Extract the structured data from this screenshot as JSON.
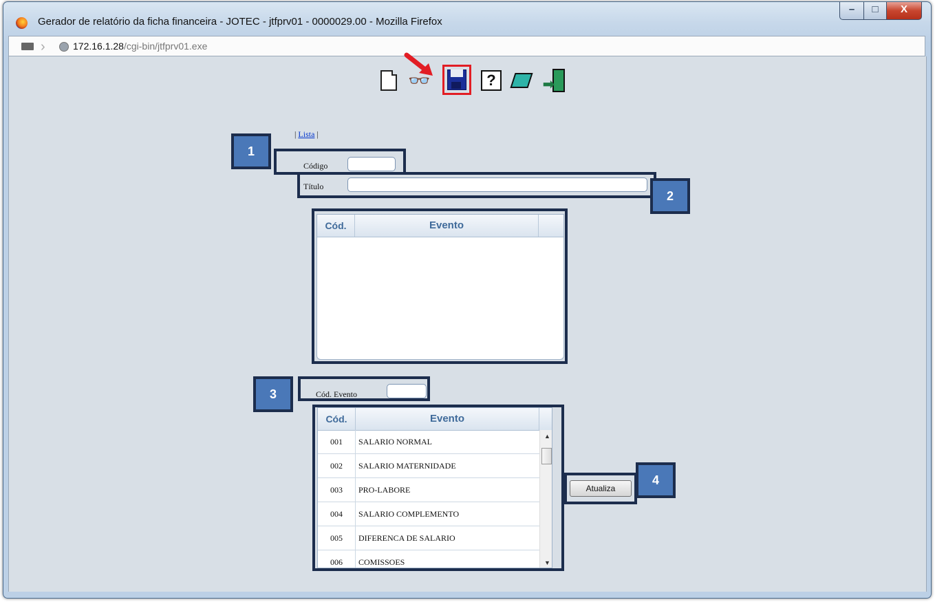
{
  "window": {
    "title": "Gerador de relatório da ficha financeira - JOTEC - jtfprv01 - 0000029.00 - Mozilla Firefox",
    "controls": {
      "minimize": "–",
      "maximize": "□",
      "close": "X"
    }
  },
  "address": {
    "host": "172.16.1.28",
    "path": "/cgi-bin/jtfprv01.exe"
  },
  "toolbar": {
    "find_glyph": "🔭",
    "help_glyph": "?"
  },
  "form": {
    "lista_prefix": "| ",
    "lista_link": "Lista",
    "lista_suffix": " |",
    "codigo_label": "Código",
    "codigo_value": "",
    "titulo_label": "Título",
    "titulo_value": "",
    "cod_evento_label": "Cód. Evento",
    "cod_evento_value": ""
  },
  "selected_grid": {
    "columns": [
      "Cód.",
      "Evento"
    ],
    "rows": []
  },
  "events_grid": {
    "columns": [
      "Cód.",
      "Evento"
    ],
    "rows": [
      {
        "code": "001",
        "name": "SALARIO NORMAL"
      },
      {
        "code": "002",
        "name": "SALARIO MATERNIDADE"
      },
      {
        "code": "003",
        "name": "PRO-LABORE"
      },
      {
        "code": "004",
        "name": "SALARIO COMPLEMENTO"
      },
      {
        "code": "005",
        "name": "DIFERENCA DE SALARIO"
      },
      {
        "code": "006",
        "name": "COMISSOES"
      }
    ]
  },
  "buttons": {
    "atualiza": "Atualiza"
  },
  "callouts": [
    "1",
    "2",
    "3",
    "4"
  ],
  "colors": {
    "highlight_red": "#e21d24",
    "callout_fill": "#4a78b8",
    "callout_border": "#1c2d4d"
  }
}
